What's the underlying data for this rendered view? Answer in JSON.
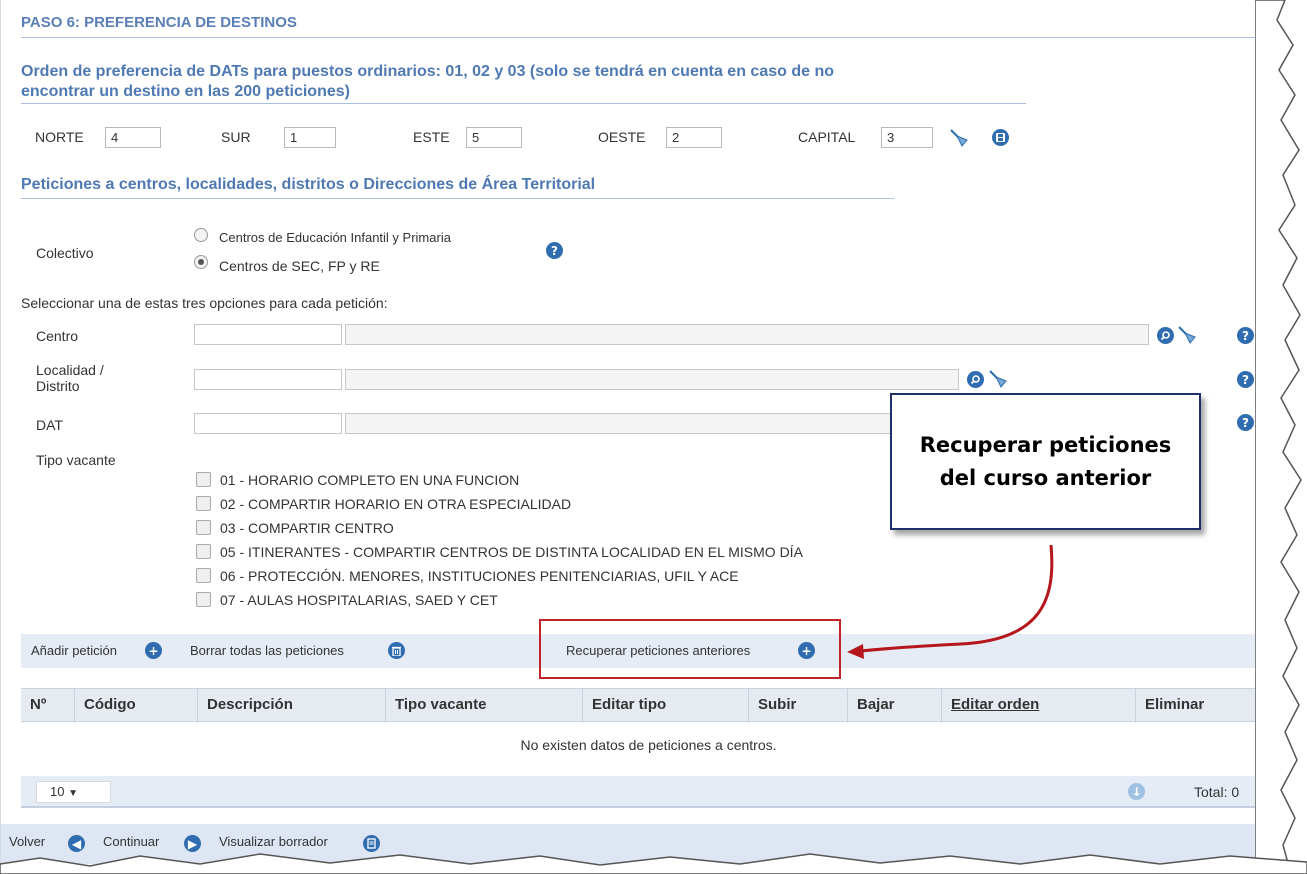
{
  "step_title": "PASO 6: PREFERENCIA DE DESTINOS",
  "dat_order": {
    "title_line1": "Orden de preferencia de DATs para puestos ordinarios: 01, 02 y 03 (solo se tendrá en cuenta en caso de no",
    "title_line2": "encontrar un destino en las 200 peticiones)",
    "fields": [
      {
        "label": "NORTE",
        "value": "4"
      },
      {
        "label": "SUR",
        "value": "1"
      },
      {
        "label": "ESTE",
        "value": "5"
      },
      {
        "label": "OESTE",
        "value": "2"
      },
      {
        "label": "CAPITAL",
        "value": "3"
      }
    ]
  },
  "requests": {
    "title": "Peticiones a centros, localidades, distritos o Direcciones de Área Territorial",
    "colectivo_label": "Colectivo",
    "colectivo_options": [
      "Centros de Educación Infantil y Primaria",
      "Centros de SEC, FP y RE"
    ],
    "colectivo_selected": "Centros de SEC, FP y RE",
    "select_hint": "Seleccionar una de estas tres opciones para cada petición:",
    "centro_label": "Centro",
    "localidad_label_1": "Localidad /",
    "localidad_label_2": "Distrito",
    "dat_label": "DAT",
    "tipo_vacante_label": "Tipo vacante",
    "tipo_vacante_options": [
      "01 - HORARIO COMPLETO EN UNA FUNCION",
      "02 - COMPARTIR HORARIO EN OTRA ESPECIALIDAD",
      "03 - COMPARTIR CENTRO",
      "05 - ITINERANTES - COMPARTIR CENTROS DE DISTINTA LOCALIDAD EN EL MISMO DÍA",
      "06 - PROTECCIÓN. MENORES, INSTITUCIONES PENITENCIARIAS, UFIL Y ACE",
      "07 - AULAS HOSPITALARIAS, SAED Y CET"
    ]
  },
  "toolbar": {
    "add": "Añadir petición",
    "delete_all": "Borrar todas las peticiones",
    "recover": "Recuperar peticiones anteriores"
  },
  "table": {
    "columns": [
      "Nº",
      "Código",
      "Descripción",
      "Tipo vacante",
      "Editar tipo",
      "Subir",
      "Bajar",
      "Editar orden",
      "Eliminar"
    ],
    "empty_message": "No existen datos de peticiones a centros.",
    "page_size": "10",
    "total": "Total: 0"
  },
  "bottom_nav": {
    "back": "Volver",
    "continue": "Continuar",
    "preview": "Visualizar borrador"
  },
  "callout": {
    "line1": "Recuperar peticiones",
    "line2": "del curso anterior"
  },
  "colors": {
    "title_blue": "#4f79b3",
    "icon_blue": "#2f6db0",
    "toolbar_bg": "#e5ecf5",
    "highlight_red": "#c0242b"
  },
  "icons": [
    "broom-icon",
    "save-icon",
    "help-icon",
    "search-icon",
    "plus-circle-icon",
    "trash-circle-icon",
    "download-icon",
    "arrow-left-icon",
    "arrow-right-icon",
    "document-icon"
  ]
}
